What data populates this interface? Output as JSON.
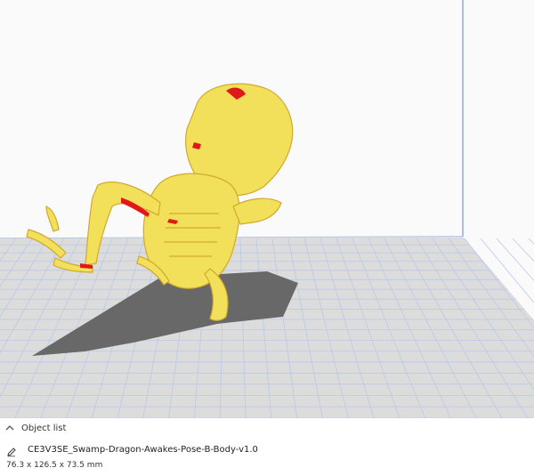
{
  "object_list": {
    "title": "Object list",
    "item_name": "CE3V3SE_Swamp-Dragon-Awakes-Pose-B-Body-v1.0",
    "dimensions": "76.3 x 126.5 x 73.5 mm"
  },
  "icons": {
    "collapse": "chevron-up-icon",
    "edit": "pencil-icon"
  },
  "colors": {
    "model": "#f2e05a",
    "overhang": "#e01818",
    "build_plate": "#dcdcdc",
    "grid_line": "#b9c9e6",
    "volume_edge": "#a9bfe8",
    "shadow": "#686868"
  }
}
